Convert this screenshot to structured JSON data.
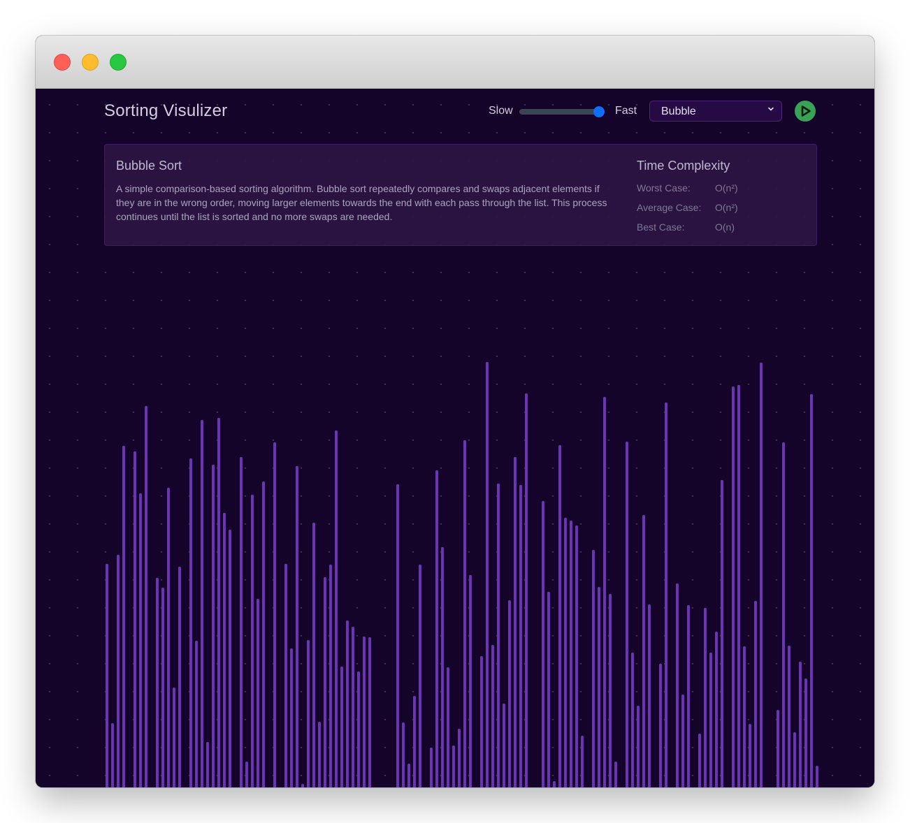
{
  "window": {
    "traffic_lights": [
      {
        "name": "close",
        "color": "#fe5f57"
      },
      {
        "name": "minimize",
        "color": "#febc2e"
      },
      {
        "name": "zoom",
        "color": "#28c840"
      }
    ]
  },
  "header": {
    "title": "Sorting Visulizer",
    "speed": {
      "slow_label": "Slow",
      "fast_label": "Fast",
      "value_fraction": 1.0
    },
    "algorithm_select": {
      "selected": "Bubble"
    },
    "play_button": {
      "icon": "play-icon",
      "color": "#38a354"
    }
  },
  "info": {
    "title": "Bubble Sort",
    "description": "A simple comparison-based sorting algorithm. Bubble sort repeatedly compares and swaps adjacent elements if they are in the wrong order, moving larger elements towards the end with each pass through the list. This process continues until the list is sorted and no more swaps are needed.",
    "complexity_title": "Time Complexity",
    "complexity": [
      {
        "label": "Worst Case:",
        "value": "O(n²)"
      },
      {
        "label": "Average Case:",
        "value": "O(n²)"
      },
      {
        "label": "Best Case:",
        "value": "O(n)"
      }
    ]
  },
  "colors": {
    "background": "#14042a",
    "bar": "#6a34b3",
    "slider_thumb": "#0d6efd"
  },
  "array": {
    "max_value": 610,
    "values": [
      320,
      92,
      333,
      489,
      0,
      481,
      421,
      546,
      0,
      300,
      286,
      429,
      143,
      316,
      0,
      471,
      210,
      526,
      65,
      462,
      529,
      393,
      369,
      0,
      473,
      37,
      419,
      270,
      438,
      0,
      494,
      0,
      320,
      199,
      460,
      5,
      211,
      379,
      94,
      301,
      319,
      511,
      173,
      239,
      230,
      166,
      216,
      215,
      0,
      0,
      0,
      0,
      434,
      93,
      34,
      131,
      319,
      0,
      57,
      454,
      344,
      172,
      60,
      84,
      497,
      304,
      0,
      188,
      609,
      204,
      435,
      120,
      268,
      473,
      433,
      564,
      0,
      0,
      410,
      280,
      9,
      490,
      386,
      382,
      375,
      74,
      0,
      340,
      287,
      559,
      277,
      37,
      0,
      495,
      193,
      117,
      390,
      262,
      0,
      177,
      551,
      0,
      292,
      133,
      261,
      0,
      77,
      257,
      193,
      223,
      440,
      0,
      574,
      576,
      202,
      91,
      267,
      608,
      0,
      0,
      111,
      494,
      203,
      79,
      180,
      156,
      563,
      31
    ]
  }
}
